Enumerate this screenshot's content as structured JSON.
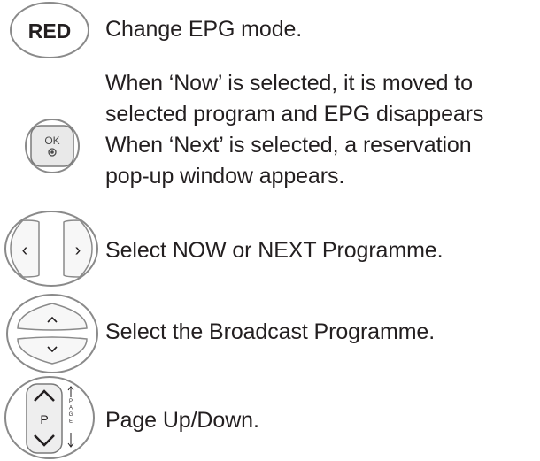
{
  "rows": [
    {
      "id": "red",
      "button_label": "RED",
      "text_lines": [
        "Change EPG mode."
      ]
    },
    {
      "id": "ok",
      "button_label": "OK",
      "text_lines": [
        "When ‘Now’ is selected, it is moved to",
        "selected program and EPG disappears",
        "When ‘Next’ is selected, a reservation",
        "pop-up window appears."
      ]
    },
    {
      "id": "left-right",
      "left_glyph": "‹",
      "right_glyph": "›",
      "text_lines": [
        "Select NOW or NEXT Programme."
      ]
    },
    {
      "id": "up-down",
      "up_glyph": "˄",
      "down_glyph": "˅",
      "text_lines": [
        "Select the Broadcast Programme."
      ]
    },
    {
      "id": "page",
      "button_label": "P",
      "side_label": "PAGE",
      "text_lines": [
        "Page Up/Down."
      ]
    }
  ],
  "colors": {
    "text": "#231f20",
    "button_stroke": "#8a8a8a",
    "button_fill": "#f2f2f2",
    "ok_fill": "#e9e9e9"
  }
}
